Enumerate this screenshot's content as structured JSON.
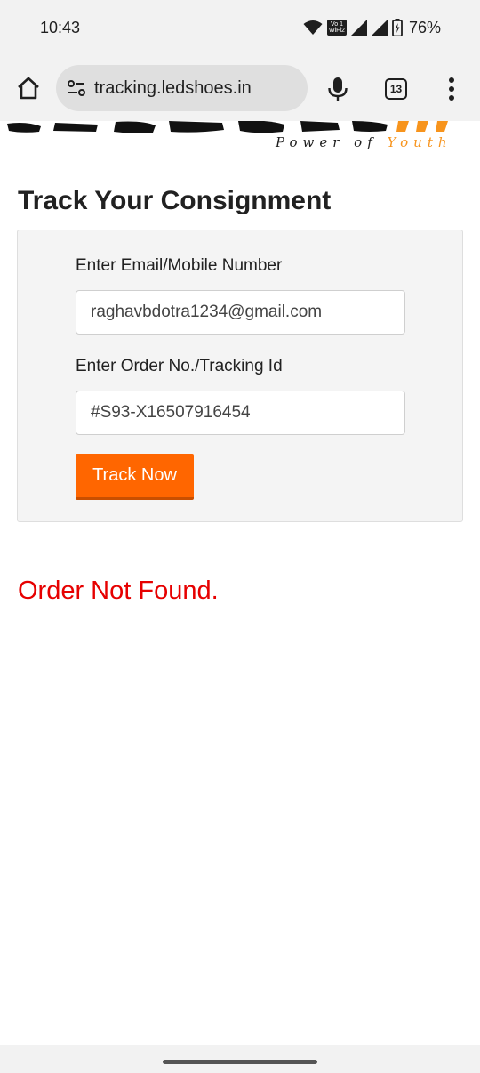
{
  "status_bar": {
    "time": "10:43",
    "volte_line1": "Vo 1",
    "volte_line2": "WiFi2",
    "battery": "76%"
  },
  "browser": {
    "url": "tracking.ledshoes.in",
    "tab_count": "13",
    "icons": [
      "home-icon",
      "site-settings-icon",
      "mic-icon",
      "tabs-icon",
      "more-vert-icon"
    ]
  },
  "brand": {
    "tagline_part1": "Power of",
    "tagline_part2": "Youth",
    "accent": "#f7941d"
  },
  "page": {
    "title": "Track Your Consignment",
    "email_label": "Enter Email/Mobile Number",
    "email_value": "raghavbdotra1234@gmail.com",
    "order_label": "Enter Order No./Tracking Id",
    "order_value": "#S93-X16507916454",
    "button_label": "Track Now",
    "button_color": "#ff6600",
    "error_message": "Order Not Found.",
    "error_color": "#e60000"
  }
}
